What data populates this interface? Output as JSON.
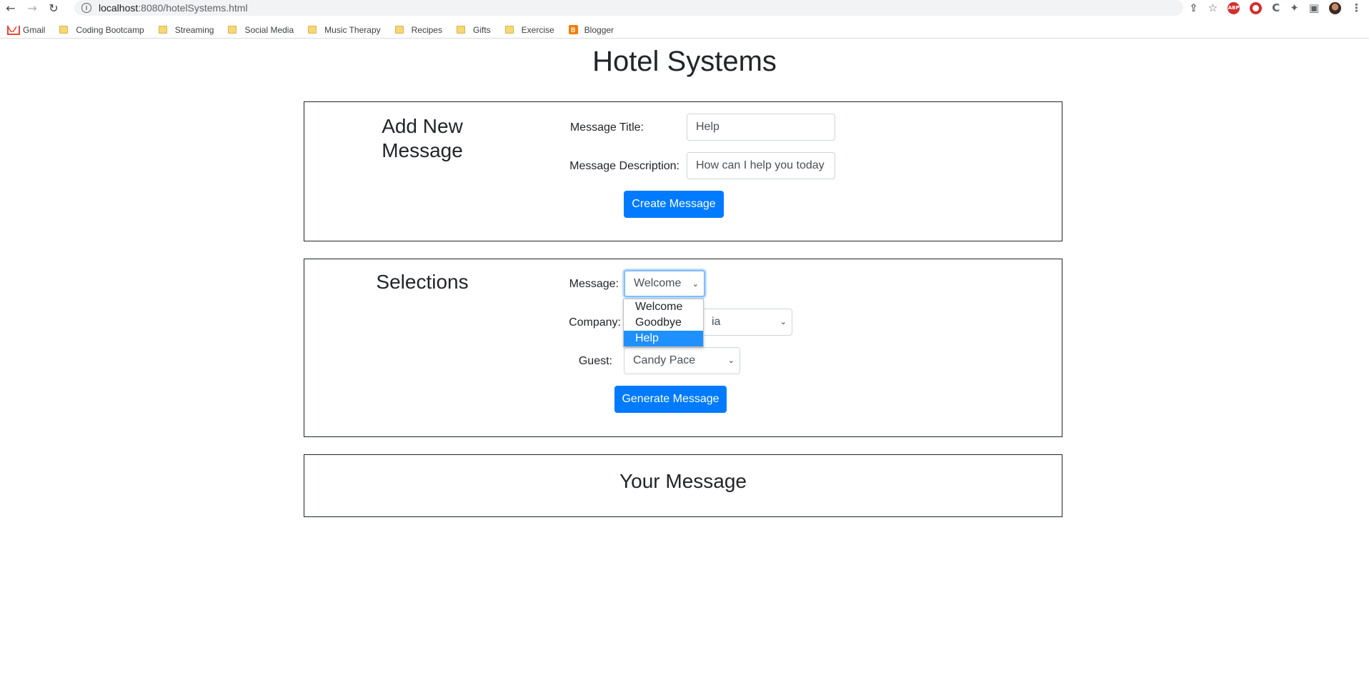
{
  "browser": {
    "url_host": "localhost",
    "url_path": ":8080/hotelSystems.html",
    "bookmarks": [
      {
        "label": "Gmail",
        "icon": "gmail-icon"
      },
      {
        "label": "Coding Bootcamp",
        "icon": "folder-icon"
      },
      {
        "label": "Streaming",
        "icon": "folder-icon"
      },
      {
        "label": "Social Media",
        "icon": "folder-icon"
      },
      {
        "label": "Music Therapy",
        "icon": "folder-icon"
      },
      {
        "label": "Recipes",
        "icon": "folder-icon"
      },
      {
        "label": "Gifts",
        "icon": "folder-icon"
      },
      {
        "label": "Exercise",
        "icon": "folder-icon"
      },
      {
        "label": "Blogger",
        "icon": "blogger-icon"
      }
    ]
  },
  "page": {
    "title": "Hotel Systems"
  },
  "add_message": {
    "heading_line1": "Add New",
    "heading_line2": "Message",
    "title_label": "Message Title:",
    "title_value": "Help",
    "description_label": "Message Description:",
    "description_value": "How can I help you today",
    "create_button": "Create Message"
  },
  "selections": {
    "heading": "Selections",
    "message_label": "Message:",
    "message_value": "Welcome",
    "message_options": [
      "Welcome",
      "Goodbye",
      "Help"
    ],
    "highlighted_option": "Help",
    "company_label": "Company:",
    "company_value_visible": "ia",
    "guest_label": "Guest:",
    "guest_value": "Candy Pace",
    "generate_button": "Generate Message"
  },
  "output": {
    "heading": "Your Message"
  },
  "colors": {
    "primary": "#007bff",
    "focus_border": "#80bdff",
    "dropdown_highlight": "#1e90ff"
  }
}
